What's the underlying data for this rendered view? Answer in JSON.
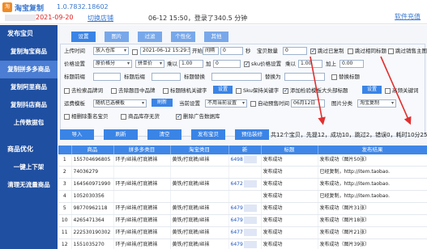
{
  "app": {
    "logo_text": "淘",
    "name": "淘宝复制",
    "version": "1.0.7832.18602",
    "software_link": "软件充值",
    "user_date": "2021-09-20",
    "switch_store": "切换店铺",
    "login_info": "06-12 15:50，登录了340.5 分钟"
  },
  "sidebar": {
    "sections": [
      {
        "title": "发布宝贝",
        "items": [
          "复制淘宝商品",
          "复制拼多多商品",
          "复制阿里商品",
          "复制抖店商品",
          "上传数据包"
        ]
      },
      {
        "title": "商品优化",
        "items": [
          "一键上下架",
          "清理无流量商品"
        ]
      }
    ],
    "active_item": "复制拼多多商品"
  },
  "tabs": [
    "设置",
    "图片",
    "过滤",
    "个性化",
    "其他"
  ],
  "settings": {
    "row1": {
      "upload_label": "上传时间",
      "upload_value": "放入仓库",
      "time_value": "2021-06-12 15:29:50",
      "start_label": "开始",
      "start_value": "间隔",
      "interval_value": "0",
      "sec": "秒",
      "qty_label": "宝贝数量",
      "qty_value": "0",
      "jump_sold": "跳过已复制",
      "jump_other": "跳过相同标题",
      "jump_sale": "跳过销售主图"
    },
    "row2": {
      "price_label": "价格设置",
      "price_value": "原价格分",
      "base_value": "拼单价",
      "mult_label": "乘以",
      "mult_value": "1.00",
      "add_label": "加",
      "add_value": "0",
      "sku_label": "sku价格设置",
      "sku_mult_label": "乘以",
      "sku_mult_value": "1.00",
      "sku_add_label": "加上",
      "sku_add_value": "0.00"
    },
    "row3": {
      "title_prefix": "标题前缀",
      "title_suffix": "标题后缀",
      "title_replace": "标题替换",
      "replace_with": "替换为",
      "replace_title": "替换标题"
    },
    "row4": {
      "opt1": "去检索品牌词",
      "opt2": "去除题目中品牌",
      "opt3": "标题随机关键字",
      "btn": "设置",
      "opt4": "Sku保持关键字",
      "opt5": "添加检验模板大头部标题",
      "btn2": "设置",
      "opt6": "高频关键词"
    },
    "row5": {
      "freight_label": "运费模板",
      "freight_value": "随机已选模板",
      "btn": "刷新",
      "attr_label": "当前设置",
      "attr_value": "不用当前设置",
      "auto_label": "自动预售时间",
      "auto_date": "06月12日",
      "img_label": "图片分类",
      "img_value": "淘宝复制"
    },
    "row6": {
      "opt1": "相删除重名宝贝",
      "opt2": "商品库存无货",
      "opt3": "删除广告数据库"
    }
  },
  "actions": {
    "buttons": [
      "导入",
      "刷新",
      "清空",
      "发布宝贝",
      "预估装修"
    ],
    "summary": "共12个宝贝，先提12，成功10，跳过2，错误0，耗时10分25秒"
  },
  "table": {
    "columns": [
      "",
      "商品",
      "拼多多类目",
      "淘宝类目",
      "新",
      "标题",
      "发布结果"
    ],
    "rows": [
      {
        "idx": "1",
        "goods": "155704696805",
        "pdd_cat": "环子/丝袜/打底裤袜",
        "tb_cat": "黄铁/打底裤/丝袜",
        "new": "6498",
        "title": "发布成功",
        "result": "发布成功（图片50张）"
      },
      {
        "idx": "2",
        "goods": "74036279",
        "pdd_cat": "",
        "tb_cat": "",
        "new": "",
        "title": "发布成功",
        "result": "已经复制，http://item.taobao."
      },
      {
        "idx": "3",
        "goods": "164560971990",
        "pdd_cat": "环子/丝袜/打底裤袜",
        "tb_cat": "黄铁/打底裤/丝袜",
        "new": "6472",
        "title": "发布成功",
        "result": "发布成功，http://item.taobao."
      },
      {
        "idx": "4",
        "goods": "1052030356",
        "pdd_cat": "",
        "tb_cat": "",
        "new": "",
        "title": "发布成功",
        "result": "已经复制，http://item.taobao."
      },
      {
        "idx": "5",
        "goods": "98770962118",
        "pdd_cat": "环子/丝袜/打底裤袜",
        "tb_cat": "黄铁/打底裤/丝袜",
        "new": "6479",
        "title": "发布成功",
        "result": "发布成功（图片31张）"
      },
      {
        "idx": "10",
        "goods": "4265471364",
        "pdd_cat": "环子/丝袜/打底裤袜",
        "tb_cat": "黄铁/打底裤/丝袜",
        "new": "6479",
        "title": "发布成功",
        "result": "发布成功（图片18张）"
      },
      {
        "idx": "11",
        "goods": "222530190302",
        "pdd_cat": "环子/丝袜/打底裤袜",
        "tb_cat": "黄铁/打底裤/丝袜",
        "new": "6477",
        "title": "发布成功",
        "result": "发布成功（图片21张）"
      },
      {
        "idx": "12",
        "goods": "1551035270",
        "pdd_cat": "环子/丝袜/打底裤袜",
        "tb_cat": "黄铁/打底裤/丝袜",
        "new": "6479",
        "title": "发布成功",
        "result": "发布成功（图片39张）"
      }
    ]
  },
  "colors": {
    "sidebar": "#1f4fa1",
    "accent": "#3a84e6",
    "arrow": "#e03030"
  }
}
